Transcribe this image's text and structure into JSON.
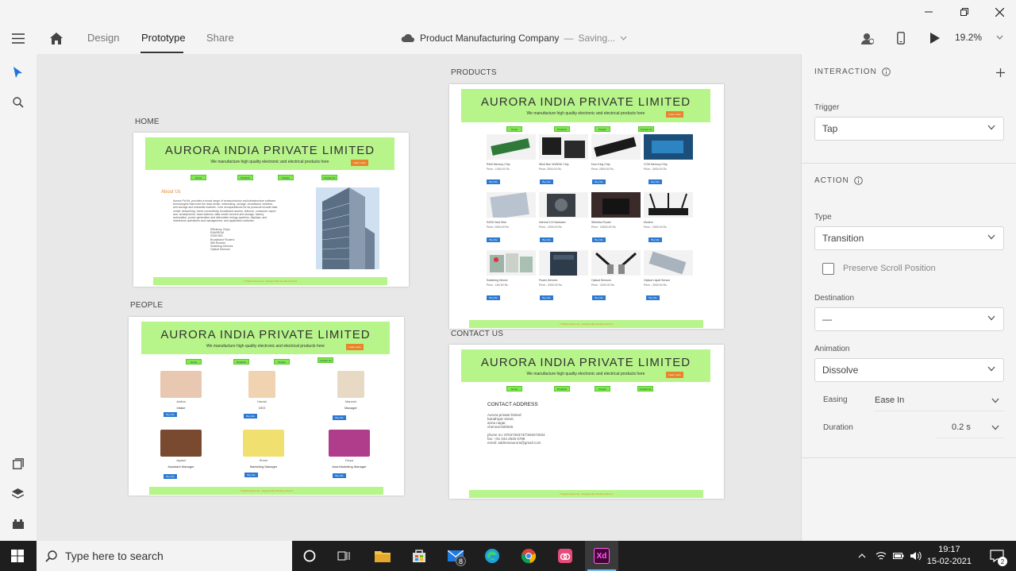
{
  "toolbar": {
    "tabs": [
      "Design",
      "Prototype",
      "Share"
    ],
    "doc_title": "Product Manufacturing Company",
    "doc_sep": "—",
    "doc_status": "Saving...",
    "zoom": "19.2%"
  },
  "canvas": {
    "home_label": "HOME",
    "people_label": "PEOPLE",
    "products_label": "PRODUCTS",
    "contact_label": "CONTACT US",
    "site_title": "AURORA  INDIA  PRIVATE  LIMITED",
    "site_tagline": "We  manufacture  high  quality  electronic  and  electrical  products  here",
    "cta": "Learn more",
    "nav": [
      "Home",
      "Products",
      "People",
      "Contact Us"
    ],
    "footer": "© Rights Reserved , Designed By Sandhya Devi.S",
    "about_title": "About Us",
    "about_text": "Aurora Pvt ltd. provides a broad range of semiconductor and infrastructure software technologies that meet the data center, networking, storage, broadband, wireless, and storage and industrial markets. Core encapsulations for its products include data center networking, home connectivity, broadband access, telecom, consumer capex and, smartphones, base stations, data center servers and storage, factory automation, power generation and alternative energy systems, displays, and mainframe operations and management, and application software.",
    "about_list": [
      "Efficiency Chips",
      "RAM/ROM",
      "SSD/HDD",
      "Broadband Routers",
      "Wifi Routers",
      "Switching Devices",
      "Optical Sensors"
    ],
    "products": [
      {
        "name": "RAM Memory Chip",
        "price": "Price : 1000.91 Rs"
      },
      {
        "name": "Wind Bmr W4502e Chip",
        "price": "Price: 2000.00 Rs"
      },
      {
        "name": "Dom King Chip",
        "price": "Price: 2500.00 Rs"
      },
      {
        "name": "CCM Memory Chip",
        "price": "Price : 3000.00 Rs"
      },
      {
        "name": "SATA Hard Disk",
        "price": "Price: 2000.00 Rs"
      },
      {
        "name": "Internal 3.5 Hardware",
        "price": "Price : 2000.00 Rs"
      },
      {
        "name": "Wireless Router",
        "price": "Price : 15000.00 Rs"
      },
      {
        "name": "Modem",
        "price": "Price : 2000.00 Rs"
      },
      {
        "name": "Switching Device",
        "price": "Price : 150.00 Rs"
      },
      {
        "name": "Power Devices",
        "price": "Price : 2000.00 Rs"
      },
      {
        "name": "Optical Sensors",
        "price": "Price : 2000.00 Rs"
      },
      {
        "name": "Optical Liquid Sensor",
        "price": "Price : 2000.00 Rs"
      }
    ],
    "buy_label": "Buy Me",
    "people": [
      {
        "name": "Anitha",
        "role": "Intake",
        "color": "#e9c8b2"
      },
      {
        "name": "Hamid",
        "role": "CEO",
        "color": "#f0d3b0"
      },
      {
        "name": "Manesh",
        "role": "Manager",
        "color": "#e8d9c4"
      },
      {
        "name": "Jayasri",
        "role": "Assistant Manager",
        "color": "#7a4a30"
      },
      {
        "name": "Shree",
        "role": "Marketing Manager",
        "color": "#f0e070"
      },
      {
        "name": "Divya",
        "role": "Asst.Marketing Manager",
        "color": "#b03c8c"
      }
    ],
    "contact": {
      "heading": "CONTACT  ADDRESS",
      "lines": [
        "Aurora private limited",
        "barathiyar street,",
        "anna nagar,",
        "chennai-600026",
        "",
        "phone no: 8764726374/7364672834",
        "fax: +91 044 2526 6798",
        "email: addressaurora@gmail.com"
      ]
    }
  },
  "panel": {
    "interaction_title": "INTERACTION",
    "trigger_label": "Trigger",
    "trigger_value": "Tap",
    "action_title": "ACTION",
    "type_label": "Type",
    "type_value": "Transition",
    "preserve_label": "Preserve Scroll Position",
    "destination_label": "Destination",
    "destination_value": "—",
    "animation_label": "Animation",
    "animation_value": "Dissolve",
    "easing_label": "Easing",
    "easing_value": "Ease In",
    "duration_label": "Duration",
    "duration_value": "0.2 s"
  },
  "taskbar": {
    "search_placeholder": "Type here to search",
    "mail_badge": "8",
    "time": "19:17",
    "date": "15-02-2021",
    "notif_count": "2"
  },
  "colors": {
    "hero_green": "#b7f48a",
    "nav_green": "#7ee84d",
    "cta_orange": "#e8852c",
    "buy_blue": "#2b79d3",
    "xd_purple": "#470137"
  }
}
